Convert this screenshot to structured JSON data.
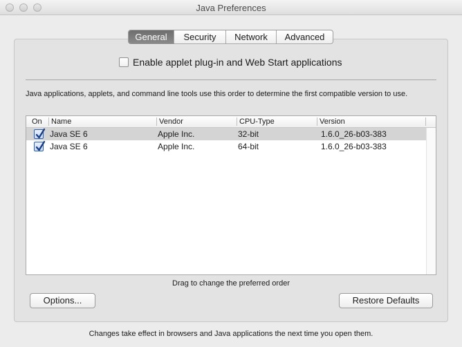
{
  "window": {
    "title": "Java Preferences"
  },
  "tabs": [
    {
      "label": "General",
      "active": true
    },
    {
      "label": "Security",
      "active": false
    },
    {
      "label": "Network",
      "active": false
    },
    {
      "label": "Advanced",
      "active": false
    }
  ],
  "general": {
    "enable_checkbox": {
      "label": "Enable applet plug-in and Web Start applications",
      "checked": false
    },
    "description": "Java applications, applets, and command line tools use this order to determine the first compatible version to use.",
    "table": {
      "columns": [
        "On",
        "Name",
        "Vendor",
        "CPU-Type",
        "Version"
      ],
      "rows": [
        {
          "on": true,
          "name": "Java SE 6",
          "vendor": "Apple Inc.",
          "cpu_type": "32-bit",
          "version": "1.6.0_26-b03-383",
          "selected": true
        },
        {
          "on": true,
          "name": "Java SE 6",
          "vendor": "Apple Inc.",
          "cpu_type": "64-bit",
          "version": "1.6.0_26-b03-383",
          "selected": false
        }
      ]
    },
    "hint": "Drag to change the preferred order",
    "options_button": "Options...",
    "restore_button": "Restore Defaults"
  },
  "footer": "Changes take effect in browsers and Java applications the next time you open them.",
  "colors": {
    "selected_row": "#d4d4d4",
    "active_tab": "#7a7a7a",
    "checkbox_accent": "#2a5fb0"
  }
}
